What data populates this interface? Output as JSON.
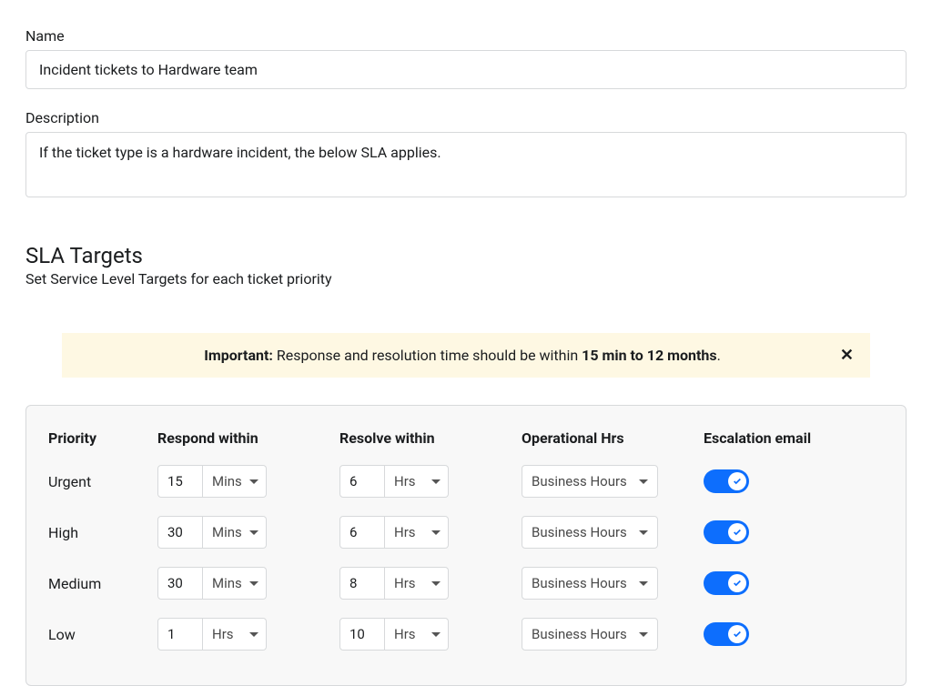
{
  "fields": {
    "name_label": "Name",
    "name_value": "Incident tickets to Hardware team",
    "description_label": "Description",
    "description_value": "If the ticket type is a hardware incident, the below SLA applies."
  },
  "sla": {
    "heading": "SLA Targets",
    "subtext": "Set Service Level Targets for each ticket priority"
  },
  "alert": {
    "prefix": "Important:",
    "mid": " Response and resolution time should be within ",
    "strong_range": "15 min to 12 months",
    "suffix": "."
  },
  "headers": {
    "priority": "Priority",
    "respond": "Respond within",
    "resolve": "Resolve within",
    "ophrs": "Operational Hrs",
    "escalation": "Escalation email"
  },
  "rows": [
    {
      "priority": "Urgent",
      "respond_val": "15",
      "respond_unit": "Mins",
      "resolve_val": "6",
      "resolve_unit": "Hrs",
      "ophrs": "Business Hours",
      "escalation": true
    },
    {
      "priority": "High",
      "respond_val": "30",
      "respond_unit": "Mins",
      "resolve_val": "6",
      "resolve_unit": "Hrs",
      "ophrs": "Business Hours",
      "escalation": true
    },
    {
      "priority": "Medium",
      "respond_val": "30",
      "respond_unit": "Mins",
      "resolve_val": "8",
      "resolve_unit": "Hrs",
      "ophrs": "Business Hours",
      "escalation": true
    },
    {
      "priority": "Low",
      "respond_val": "1",
      "respond_unit": "Hrs",
      "resolve_val": "10",
      "resolve_unit": "Hrs",
      "ophrs": "Business Hours",
      "escalation": true
    }
  ]
}
